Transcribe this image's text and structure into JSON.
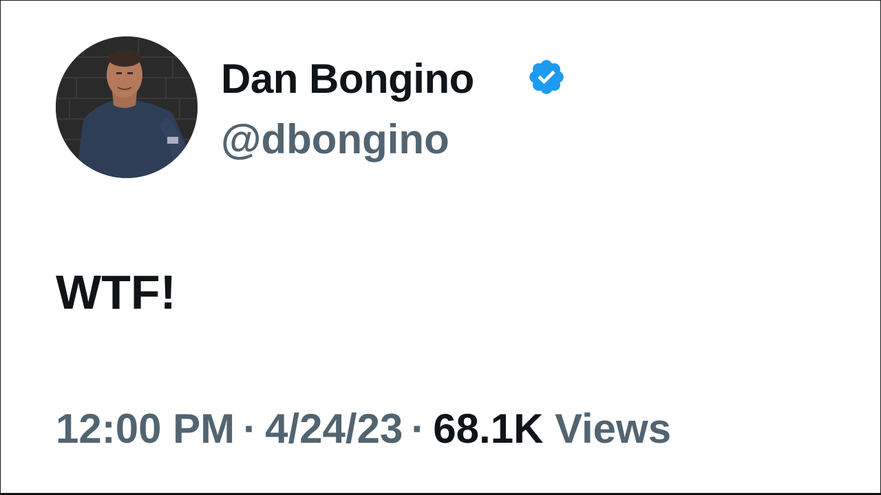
{
  "author": {
    "display_name": "Dan Bongino",
    "handle": "@dbongino",
    "verified": true,
    "verified_color": "#1d9bf0",
    "avatar_icon": "profile-photo"
  },
  "tweet": {
    "text": "WTF!"
  },
  "meta": {
    "time": "12:00 PM",
    "separator": "·",
    "date": "4/24/23",
    "views_count": "68.1K",
    "views_label": "Views"
  },
  "colors": {
    "primary_text": "#0f1419",
    "secondary_text": "#536471",
    "background": "#ffffff"
  }
}
